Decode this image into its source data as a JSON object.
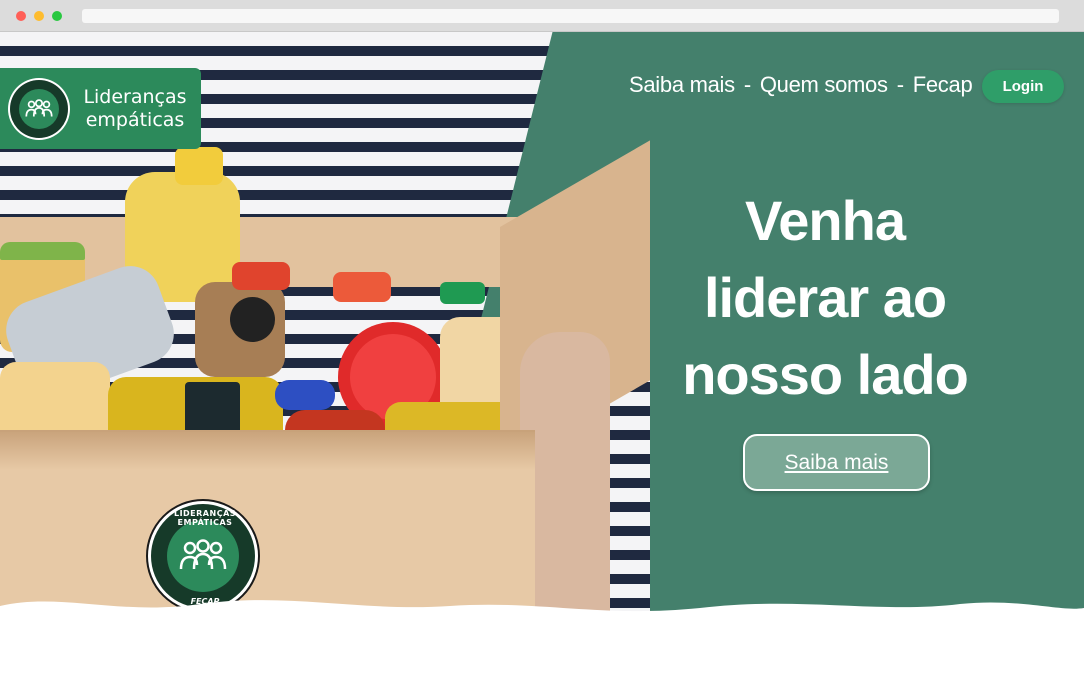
{
  "browser": {
    "address": ""
  },
  "brand": {
    "name_line1": "Lideranças",
    "name_line2": "empáticas",
    "logo_ring_text": "LIDERANÇAS EMPÁTICAS",
    "logo_sub": "FECAP",
    "accent": "#2c8a5b"
  },
  "nav": {
    "items": [
      "Saiba mais",
      "Quem somos",
      "Fecap"
    ],
    "separator": "-",
    "login_label": "Login"
  },
  "hero": {
    "headline": [
      "Venha",
      "liderar ao",
      "nosso lado"
    ],
    "cta_label": "Saiba mais",
    "background": "#44806c"
  },
  "seal": {
    "ring_text": "LIDERANÇAS EMPÁTICAS",
    "sub": "FECAP"
  }
}
